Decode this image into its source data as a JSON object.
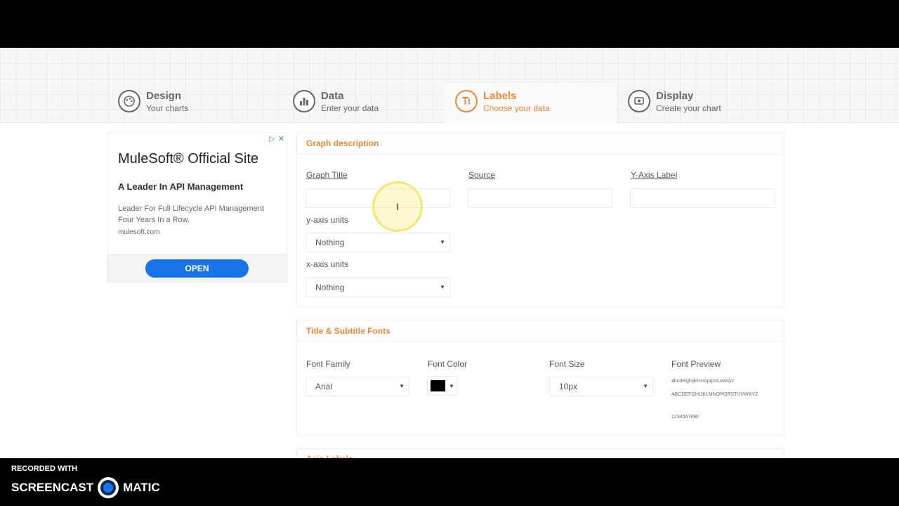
{
  "stepper": {
    "steps": [
      {
        "title": "Design",
        "sub": "Your charts",
        "icon": "palette-icon"
      },
      {
        "title": "Data",
        "sub": "Enter your data",
        "icon": "bar-chart-icon"
      },
      {
        "title": "Labels",
        "sub": "Choose your data",
        "icon": "text-label-icon"
      },
      {
        "title": "Display",
        "sub": "Create your chart",
        "icon": "monitor-icon"
      }
    ],
    "active": 2,
    "accent": "#e8883a"
  },
  "ad": {
    "title": "MuleSoft® Official Site",
    "tagline": "A Leader In API Management",
    "description": "Leader For Full Lifecycle API Management Four Years In a Row.",
    "url": "mulesoft.com",
    "button": "OPEN",
    "button_color": "#1a73e8"
  },
  "graph_description": {
    "header": "Graph description",
    "graph_title_label": "Graph Title",
    "source_label": "Source",
    "y_axis_label": "Y-Axis Label",
    "graph_title_value": "",
    "source_value": "",
    "y_axis_value": "",
    "y_units_label": "y-axis units",
    "y_units_value": "Nothing",
    "x_units_label": "x-axis units",
    "x_units_value": "Nothing"
  },
  "fonts": {
    "header": "Title & Subtitle Fonts",
    "family_label": "Font Family",
    "family_value": "Arial",
    "color_label": "Font Color",
    "color_value": "#000000",
    "size_label": "Font Size",
    "size_value": "10px",
    "preview_label": "Font Preview",
    "preview_lower": "abcdefghijklmnopqrstuvwxyz",
    "preview_upper": "ABCDEFGHIJKLMNOPQRSTUVWXYZ",
    "preview_digits": "1234567890"
  },
  "next_section": "Axis Labels",
  "watermark": {
    "recorded": "RECORDED WITH",
    "brand_left": "SCREENCAST",
    "brand_right": "MATIC"
  }
}
